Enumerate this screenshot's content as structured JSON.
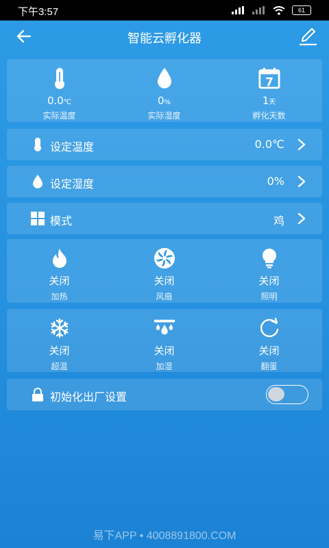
{
  "status_bar": {
    "time": "下午3:57",
    "battery": "61"
  },
  "header": {
    "title": "智能云孵化器"
  },
  "stats": [
    {
      "value": "0.0",
      "unit": "℃",
      "label": "实际温度",
      "icon": "thermometer-icon"
    },
    {
      "value": "0",
      "unit": "%",
      "label": "实际湿度",
      "icon": "water-drop-icon"
    },
    {
      "value": "1",
      "unit": "天",
      "label": "孵化天数",
      "icon": "calendar-icon",
      "calendar_day": "7"
    }
  ],
  "settings": [
    {
      "label": "设定温度",
      "value": "0.0℃",
      "icon": "thermometer-icon"
    },
    {
      "label": "设定湿度",
      "value": "0%",
      "icon": "water-drop-icon"
    },
    {
      "label": "模式",
      "value": "鸡",
      "icon": "grid-icon"
    }
  ],
  "controls_row1": [
    {
      "state": "关闭",
      "label": "加热",
      "icon": "flame-icon"
    },
    {
      "state": "关闭",
      "label": "风扇",
      "icon": "fan-icon"
    },
    {
      "state": "关闭",
      "label": "照明",
      "icon": "bulb-icon"
    }
  ],
  "controls_row2": [
    {
      "state": "关闭",
      "label": "超温",
      "icon": "snowflake-icon"
    },
    {
      "state": "关闭",
      "label": "加湿",
      "icon": "humidifier-icon"
    },
    {
      "state": "关闭",
      "label": "翻蛋",
      "icon": "rotate-icon"
    }
  ],
  "factory_reset": {
    "label": "初始化出厂设置",
    "enabled": false
  },
  "watermark": "易下APP • 4008891800.COM"
}
